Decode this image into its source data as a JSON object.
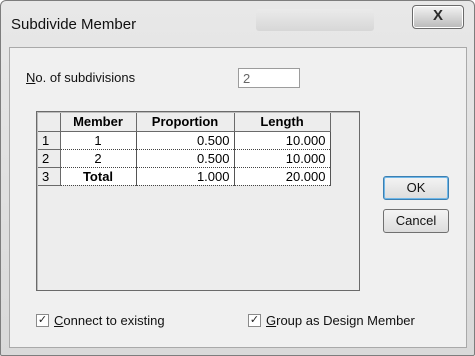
{
  "window": {
    "title": "Subdivide Member",
    "close_glyph": "X"
  },
  "subdivisions": {
    "label_underlined": "N",
    "label_rest": "o. of subdivisions",
    "value": "2"
  },
  "grid": {
    "headers": [
      "",
      "Member",
      "Proportion",
      "Length"
    ],
    "rows": [
      {
        "num": "1",
        "member": "1",
        "proportion": "0.500",
        "length": "10.000"
      },
      {
        "num": "2",
        "member": "2",
        "proportion": "0.500",
        "length": "10.000"
      },
      {
        "num": "3",
        "member": "Total",
        "proportion": "1.000",
        "length": "20.000"
      }
    ]
  },
  "buttons": {
    "ok": "OK",
    "cancel": "Cancel"
  },
  "checkboxes": {
    "connect": {
      "underlined": "C",
      "rest": "onnect to existing",
      "checked": true
    },
    "group": {
      "underlined": "G",
      "rest": "roup as Design Member",
      "checked": true
    }
  }
}
